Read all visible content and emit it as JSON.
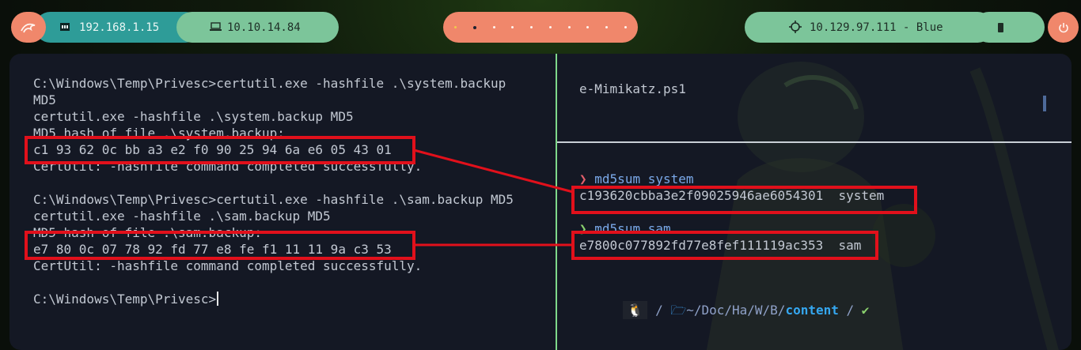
{
  "topbar": {
    "logo_icon": "kali-dragon-icon",
    "local_ip": "192.168.1.15",
    "vpn_ip": "10.10.14.84",
    "target": "10.129.97.111 - Blue",
    "workspaces": [
      "1",
      "2",
      "3",
      "4",
      "5",
      "6",
      "7",
      "8",
      "9",
      "10"
    ],
    "active_workspace": "2"
  },
  "left_pane": {
    "lines": [
      "C:\\Windows\\Temp\\Privesc>certutil.exe -hashfile .\\system.backup",
      "MD5",
      "certutil.exe -hashfile .\\system.backup MD5",
      "MD5 hash of file .\\system.backup:",
      "c1 93 62 0c bb a3 e2 f0 90 25 94 6a e6 05 43 01",
      "CertUtil: -hashfile command completed successfully.",
      "",
      "C:\\Windows\\Temp\\Privesc>certutil.exe -hashfile .\\sam.backup MD5",
      "certutil.exe -hashfile .\\sam.backup MD5",
      "MD5 hash of file .\\sam.backup:",
      "e7 80 0c 07 78 92 fd 77 e8 fe f1 11 11 9a c3 53",
      "CertUtil: -hashfile command completed successfully.",
      "",
      "C:\\Windows\\Temp\\Privesc>"
    ]
  },
  "right_top_pane": {
    "text": "e-Mimikatz.ps1"
  },
  "right_bottom_pane": {
    "cmd1_prompt": "❯",
    "cmd1": "md5sum system",
    "out1": "c193620cbba3e2f09025946ae6054301  system",
    "cmd2_prompt": "❯",
    "cmd2": "md5sum sam",
    "out2": "e7800c077892fd77e8fef111119ac353  sam",
    "path_prefix": "~/Doc/Ha/W/B/",
    "path_current": "content",
    "path_sep": "/",
    "status_check": "✔"
  },
  "colors": {
    "highlight": "#e1101b",
    "accent_orange": "#f0876b",
    "accent_green": "#7cc59a",
    "accent_teal": "#2e9c98"
  }
}
